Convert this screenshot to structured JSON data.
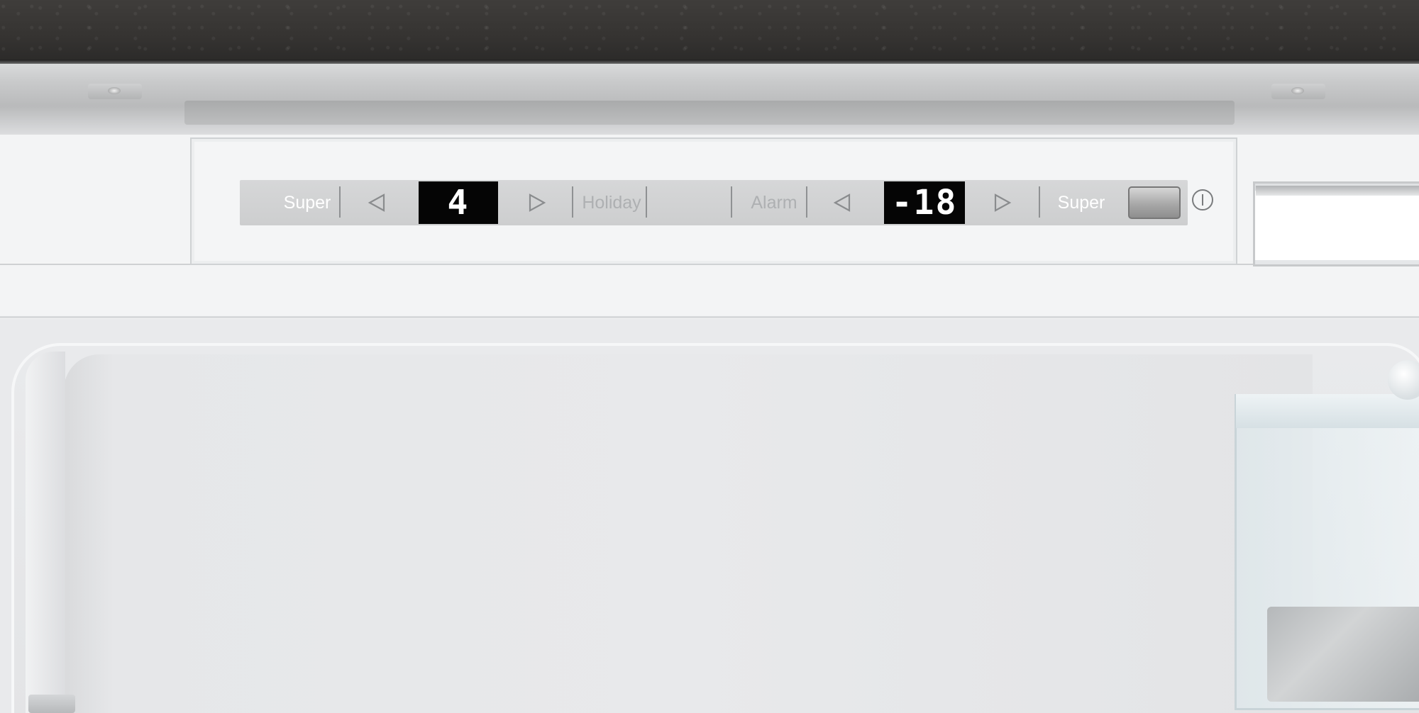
{
  "control_panel": {
    "fridge": {
      "super_label": "Super",
      "temperature": "4"
    },
    "holiday_label": "Holiday",
    "freezer": {
      "alarm_label": "Alarm",
      "temperature": "-18",
      "super_label": "Super"
    }
  },
  "icons": {
    "decrease": "triangle-left-icon",
    "increase": "triangle-right-icon",
    "power": "power-icon"
  },
  "colors": {
    "display_background": "#050505",
    "display_digits": "#ffffff",
    "label_active": "#ffffff",
    "label_inactive": "#aeb0b2"
  }
}
